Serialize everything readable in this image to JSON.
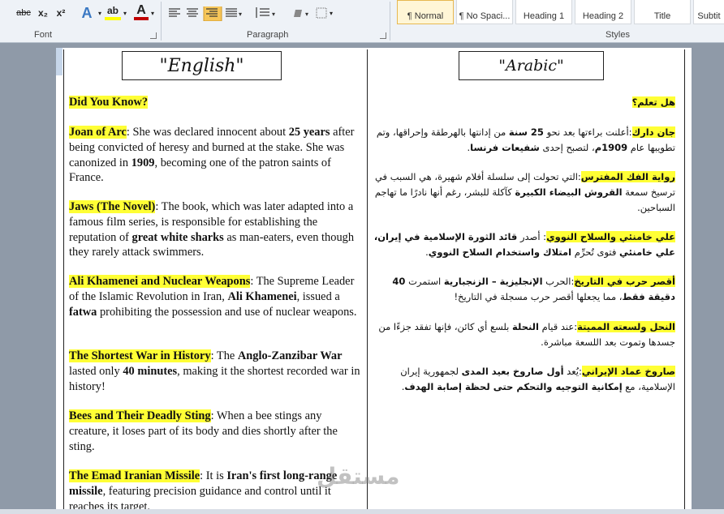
{
  "ribbon": {
    "font_group": {
      "label": "Font",
      "buttons": {
        "strike": "abc",
        "subscript": "x₂",
        "superscript": "x²",
        "text_effects": "A",
        "highlight": "ab",
        "font_color": "A"
      }
    },
    "paragraph_group": {
      "label": "Paragraph"
    },
    "styles_group": {
      "label": "Styles",
      "items": [
        "¶ Normal",
        "¶ No Spaci...",
        "Heading 1",
        "Heading 2",
        "Title",
        "Subtit"
      ]
    },
    "colors": {
      "highlight": "#ffff00",
      "font_color": "#c00000"
    }
  },
  "document": {
    "english_title": "\"English\"",
    "arabic_title": "\"Arabic\"",
    "english": {
      "intro": {
        "box": "",
        "label": "Did You Know?",
        "box2": ""
      },
      "items": [
        {
          "box": "",
          "title": "Joan of Arc",
          "parts": [
            ": She was declared innocent about ",
            "25 years",
            " after being convicted of heresy and burned at the stake. She was canonized in ",
            "1909",
            ", becoming one of the patron saints of France."
          ]
        },
        {
          "box": "",
          "title": "Jaws (The Novel)",
          "parts": [
            ": The book, which was later adapted into a famous film series, is responsible  for establishing the reputation of ",
            "great white sharks",
            " as man-eaters, even though they rarely  attack swimmers."
          ]
        },
        {
          "box": "",
          "title": "Ali Khamenei and Nuclear Weapons",
          "parts": [
            ": The Supreme Leader of the Islamic Revolution in Iran, ",
            "Ali Khamenei",
            ", issued a ",
            "fatwa",
            " prohibiting the possession and use of nuclear weapons."
          ]
        },
        {
          "box": "",
          "title": "The Shortest War in History",
          "parts": [
            ": The ",
            "Anglo-Zanzibar War",
            " lasted only ",
            "40 minutes",
            ", making it the shortest recorded war in history!"
          ]
        },
        {
          "box": "",
          "title": "Bees and Their Deadly Sting",
          "parts": [
            ": When a bee stings any creature, it loses part of its body and dies shortly after the sting."
          ]
        },
        {
          "box": "",
          "title": "The Emad Iranian Missile",
          "parts": [
            ":  It is ",
            "Iran's first long-range missile",
            ",  featuring precision  guidance and control until it reaches its target."
          ]
        }
      ]
    },
    "arabic": {
      "intro": {
        "box": "",
        "label": "هل تعلم؟",
        "box2": ""
      },
      "items": [
        {
          "box": "",
          "title": "جان دارك",
          "parts": [
            ":أعلنت براءتها بعد نحو ",
            "25 سنة",
            " من إدانتها بالهرطقة وإحراقها، وتم تطويبها عام ",
            "1909م",
            "، لتصبح إحدى ",
            "شفيعات فرنسا",
            "."
          ]
        },
        {
          "box": "",
          "title": "رواية الفك المفترس",
          "parts": [
            ":التي تحولت إلى سلسلة أفلام شهيرة، هي السبب في ترسيخ سمعة ",
            "القروش البيضاء الكبيرة",
            " كآكلة للبشر، رغم أنها نادرًا ما تهاجم السباحين."
          ]
        },
        {
          "box": "",
          "title": "علي خامنئي والسلاح النووي",
          "parts": [
            ": أصدر ",
            "قائد الثورة الإسلامية في إيران، علي خامنئي",
            " فتوى تُحرِّم ",
            "امتلاك واستخدام السلاح النووي",
            "."
          ]
        },
        {
          "box": "",
          "title": "أقصر حرب في التاريخ",
          "parts": [
            ":الحرب ",
            "الإنجليزية – الزنجبارية",
            " استمرت ",
            "40 دقيقة فقط",
            "، مما يجعلها أقصر حرب مسجلة في التاريخ!"
          ]
        },
        {
          "box": "",
          "title": "النحل ولسعته المميتة",
          "parts": [
            ":عند قيام ",
            "النحلة",
            " بلسع أي كائن، فإنها تفقد جزءًا من جسدها وتموت بعد اللسعة مباشرة."
          ]
        },
        {
          "box": "",
          "title": "صاروخ عماد الإيراني",
          "parts": [
            ":يُعد ",
            "أول صاروخ بعيد المدى",
            " لجمهورية إيران الإسلامية، مع ",
            "إمكانية التوجيه والتحكم حتى لحظة إصابة الهدف",
            "."
          ]
        }
      ]
    },
    "watermark": "مستقل"
  }
}
